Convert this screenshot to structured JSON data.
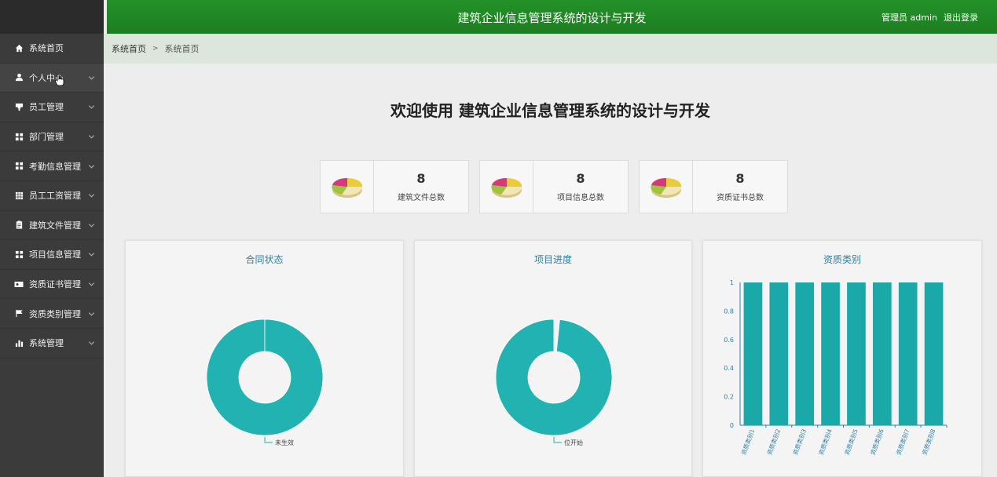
{
  "app": {
    "title": "建筑企业信息管理系统的设计与开发",
    "user_label": "管理员 admin",
    "logout": "退出登录",
    "accent_color": "#22882a"
  },
  "sidebar": {
    "items": [
      {
        "label": "系统首页",
        "icon": "home-icon"
      },
      {
        "label": "个人中心",
        "icon": "user-icon"
      },
      {
        "label": "员工管理",
        "icon": "trophy-icon"
      },
      {
        "label": "部门管理",
        "icon": "grid-icon"
      },
      {
        "label": "考勤信息管理",
        "icon": "grid-icon"
      },
      {
        "label": "员工工资管理",
        "icon": "table-icon"
      },
      {
        "label": "建筑文件管理",
        "icon": "clipboard-icon"
      },
      {
        "label": "项目信息管理",
        "icon": "grid-icon"
      },
      {
        "label": "资质证书管理",
        "icon": "id-card-icon"
      },
      {
        "label": "资质类别管理",
        "icon": "flag-icon"
      },
      {
        "label": "系统管理",
        "icon": "bar-chart-icon"
      }
    ]
  },
  "breadcrumb": {
    "home": "系统首页",
    "separator": ">",
    "current": "系统首页"
  },
  "welcome": "欢迎使用 建筑企业信息管理系统的设计与开发",
  "stats": [
    {
      "value": "8",
      "label": "建筑文件总数",
      "icon": "pie-chart-icon"
    },
    {
      "value": "8",
      "label": "项目信息总数",
      "icon": "pie-chart-icon"
    },
    {
      "value": "8",
      "label": "资质证书总数",
      "icon": "pie-chart-icon"
    }
  ],
  "charts": [
    {
      "title": "合同状态"
    },
    {
      "title": "项目进度"
    },
    {
      "title": "资质类别"
    }
  ],
  "chart_data": [
    {
      "type": "pie",
      "title": "合同状态",
      "categories": [
        "未生效"
      ],
      "values": [
        1
      ],
      "color": "#22b2b2"
    },
    {
      "type": "pie",
      "title": "项目进度",
      "categories": [
        "位开始"
      ],
      "values": [
        1
      ],
      "color": "#22b2b2"
    },
    {
      "type": "bar",
      "title": "资质类别",
      "categories": [
        "资质类别1",
        "资质类别2",
        "资质类别3",
        "资质类别4",
        "资质类别5",
        "资质类别6",
        "资质类别7",
        "资质类别8"
      ],
      "values": [
        1,
        1,
        1,
        1,
        1,
        1,
        1,
        1
      ],
      "ylim": [
        0,
        1
      ],
      "yticks": [
        "0",
        "0.2",
        "0.4",
        "0.6",
        "0.8",
        "1"
      ],
      "color": "#1aa8a8"
    }
  ]
}
